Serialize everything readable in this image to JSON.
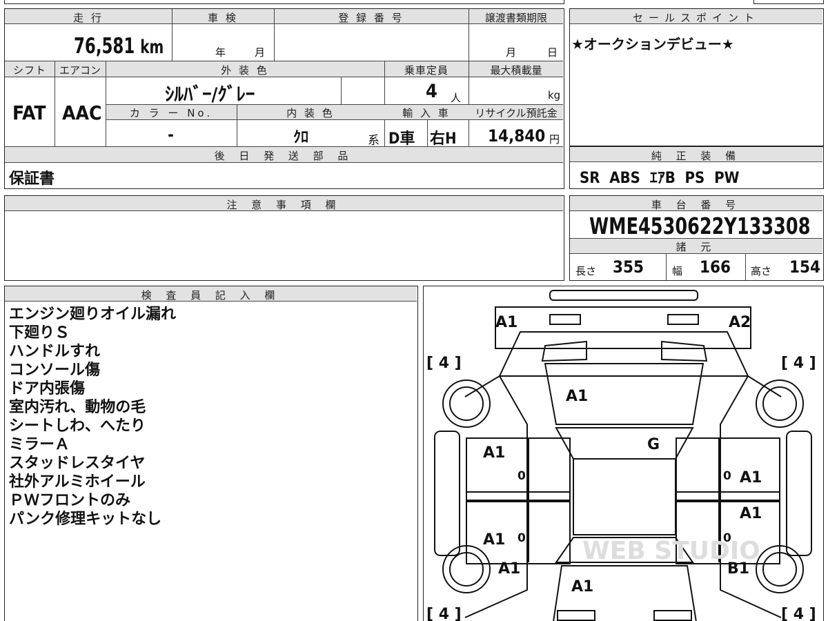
{
  "top_strip": {
    "partial_text": "…"
  },
  "mileage": {
    "label": "走 行",
    "value": "76,581",
    "unit": "km"
  },
  "inspection": {
    "label": "車 検",
    "year": "年",
    "month": "月"
  },
  "registration": {
    "label": "登 録 番 号",
    "value": ""
  },
  "transfer_deadline": {
    "label": "譲渡書類期限",
    "month": "月",
    "day": "日"
  },
  "sales_point": {
    "label": "セールスポイント",
    "text": "★オークションデビュー★"
  },
  "shift": {
    "label": "シフト",
    "value": "FAT"
  },
  "aircon": {
    "label": "エアコン",
    "value": "AAC"
  },
  "exterior_color": {
    "label": "外 装 色",
    "value": "ｼﾙﾊﾞｰ/ｸﾞﾚｰ"
  },
  "capacity": {
    "label": "乗車定員",
    "value": "4",
    "unit": "人"
  },
  "max_load": {
    "label": "最大積載量",
    "value": "",
    "unit": "kg"
  },
  "color_no": {
    "label": "カ ラ ー No.",
    "value": "-"
  },
  "interior_color": {
    "label": "内 装 色",
    "value": "ｸﾛ",
    "suffix": "系"
  },
  "import": {
    "label": "輸 入 車",
    "dealer": "D車",
    "handle": "右H"
  },
  "recycle": {
    "label": "リサイクル預託金",
    "value": "14,840",
    "unit": "円"
  },
  "later_parts": {
    "label": "後 日 発 送 部 品",
    "value": "保証書"
  },
  "genuine_equipment": {
    "label": "純 正 装 備",
    "value": "SR  ABS  ｴｱB  PS  PW"
  },
  "caution": {
    "label": "注 意 事 項 欄",
    "value": ""
  },
  "chassis_number": {
    "label": "車 台 番 号",
    "value": "WME4530622Y133308"
  },
  "specs": {
    "label": "諸 元",
    "length_label": "長さ",
    "length": "355",
    "width_label": "幅",
    "width": "166",
    "height_label": "高さ",
    "height": "154"
  },
  "inspector": {
    "label": "検 査 員 記 入 欄",
    "notes": [
      "エンジン廻りオイル漏れ",
      "下廻りＳ",
      "ハンドルすれ",
      "コンソール傷",
      "ドア内張傷",
      "室内汚れ、動物の毛",
      "シートしわ、へたり",
      "ミラーＡ",
      "スタッドレスタイヤ",
      "社外アルミホイール",
      "ＰＷフロントのみ",
      "パンク修理キットなし"
    ]
  },
  "diagram": {
    "watermark": "WEB STUDIO",
    "tire_top_left": "[ 4 ]",
    "tire_top_right": "[ 4 ]",
    "tire_bottom_left": "[ 4 ]",
    "tire_bottom_right": "[ 4 ]",
    "marks": {
      "front_left": "A1",
      "front_right": "A2",
      "hood": "A1",
      "windshield": "G",
      "front_door_left": "A1",
      "front_door_right": "A1",
      "rear_door_right": "A1",
      "rear_door_left": "A1",
      "rear_fender_left": "A1",
      "rear_fender_right": "B1",
      "trunk": "A1",
      "zero_a": "0",
      "zero_b": "0",
      "zero_c": "0",
      "zero_d": "0"
    }
  }
}
